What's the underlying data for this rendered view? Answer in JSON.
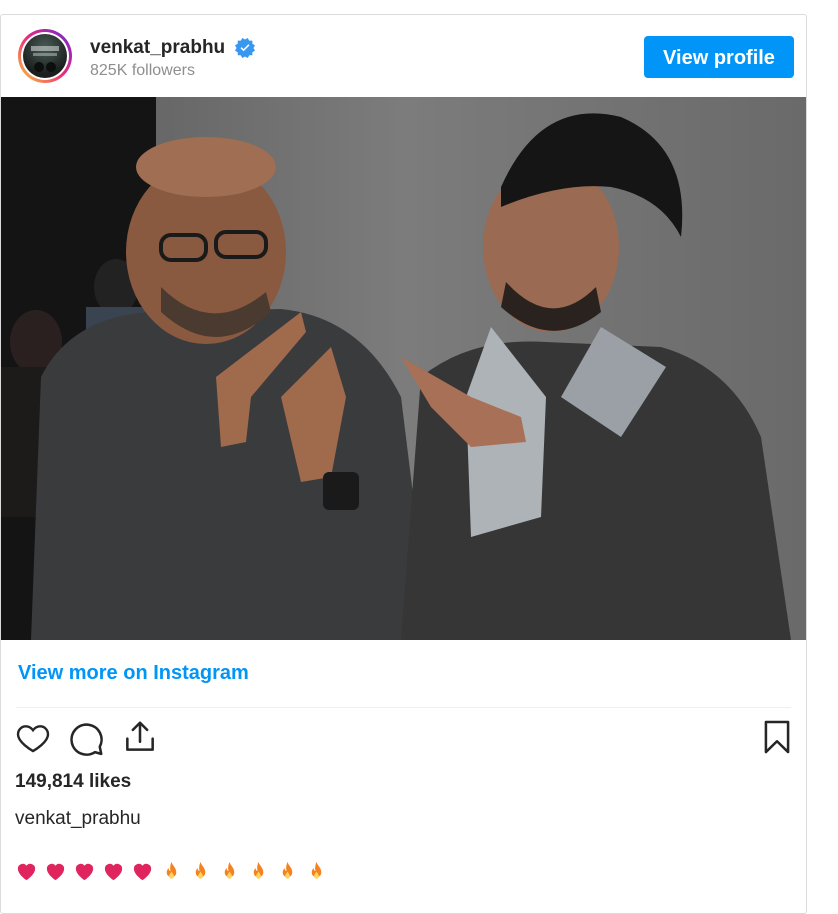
{
  "header": {
    "username": "venkat_prabhu",
    "followers": "825K followers",
    "view_profile_label": "View profile",
    "verified": true
  },
  "post": {
    "image_alt": "Photo of two men gesturing at each other",
    "view_more_label": "View more on Instagram",
    "likes": "149,814 likes",
    "caption_username": "venkat_prabhu",
    "caption_emojis": [
      "heart",
      "heart",
      "heart",
      "heart",
      "heart",
      "fire",
      "fire",
      "fire",
      "fire",
      "fire",
      "fire"
    ]
  },
  "actions": {
    "like_icon": "heart-outline-icon",
    "comment_icon": "comment-bubble-icon",
    "share_icon": "share-upload-icon",
    "save_icon": "bookmark-icon"
  },
  "colors": {
    "accent": "#0095f6",
    "text": "#262626",
    "muted": "#8e8e8e",
    "heart": "#e0245e",
    "fire": "#f58220"
  }
}
